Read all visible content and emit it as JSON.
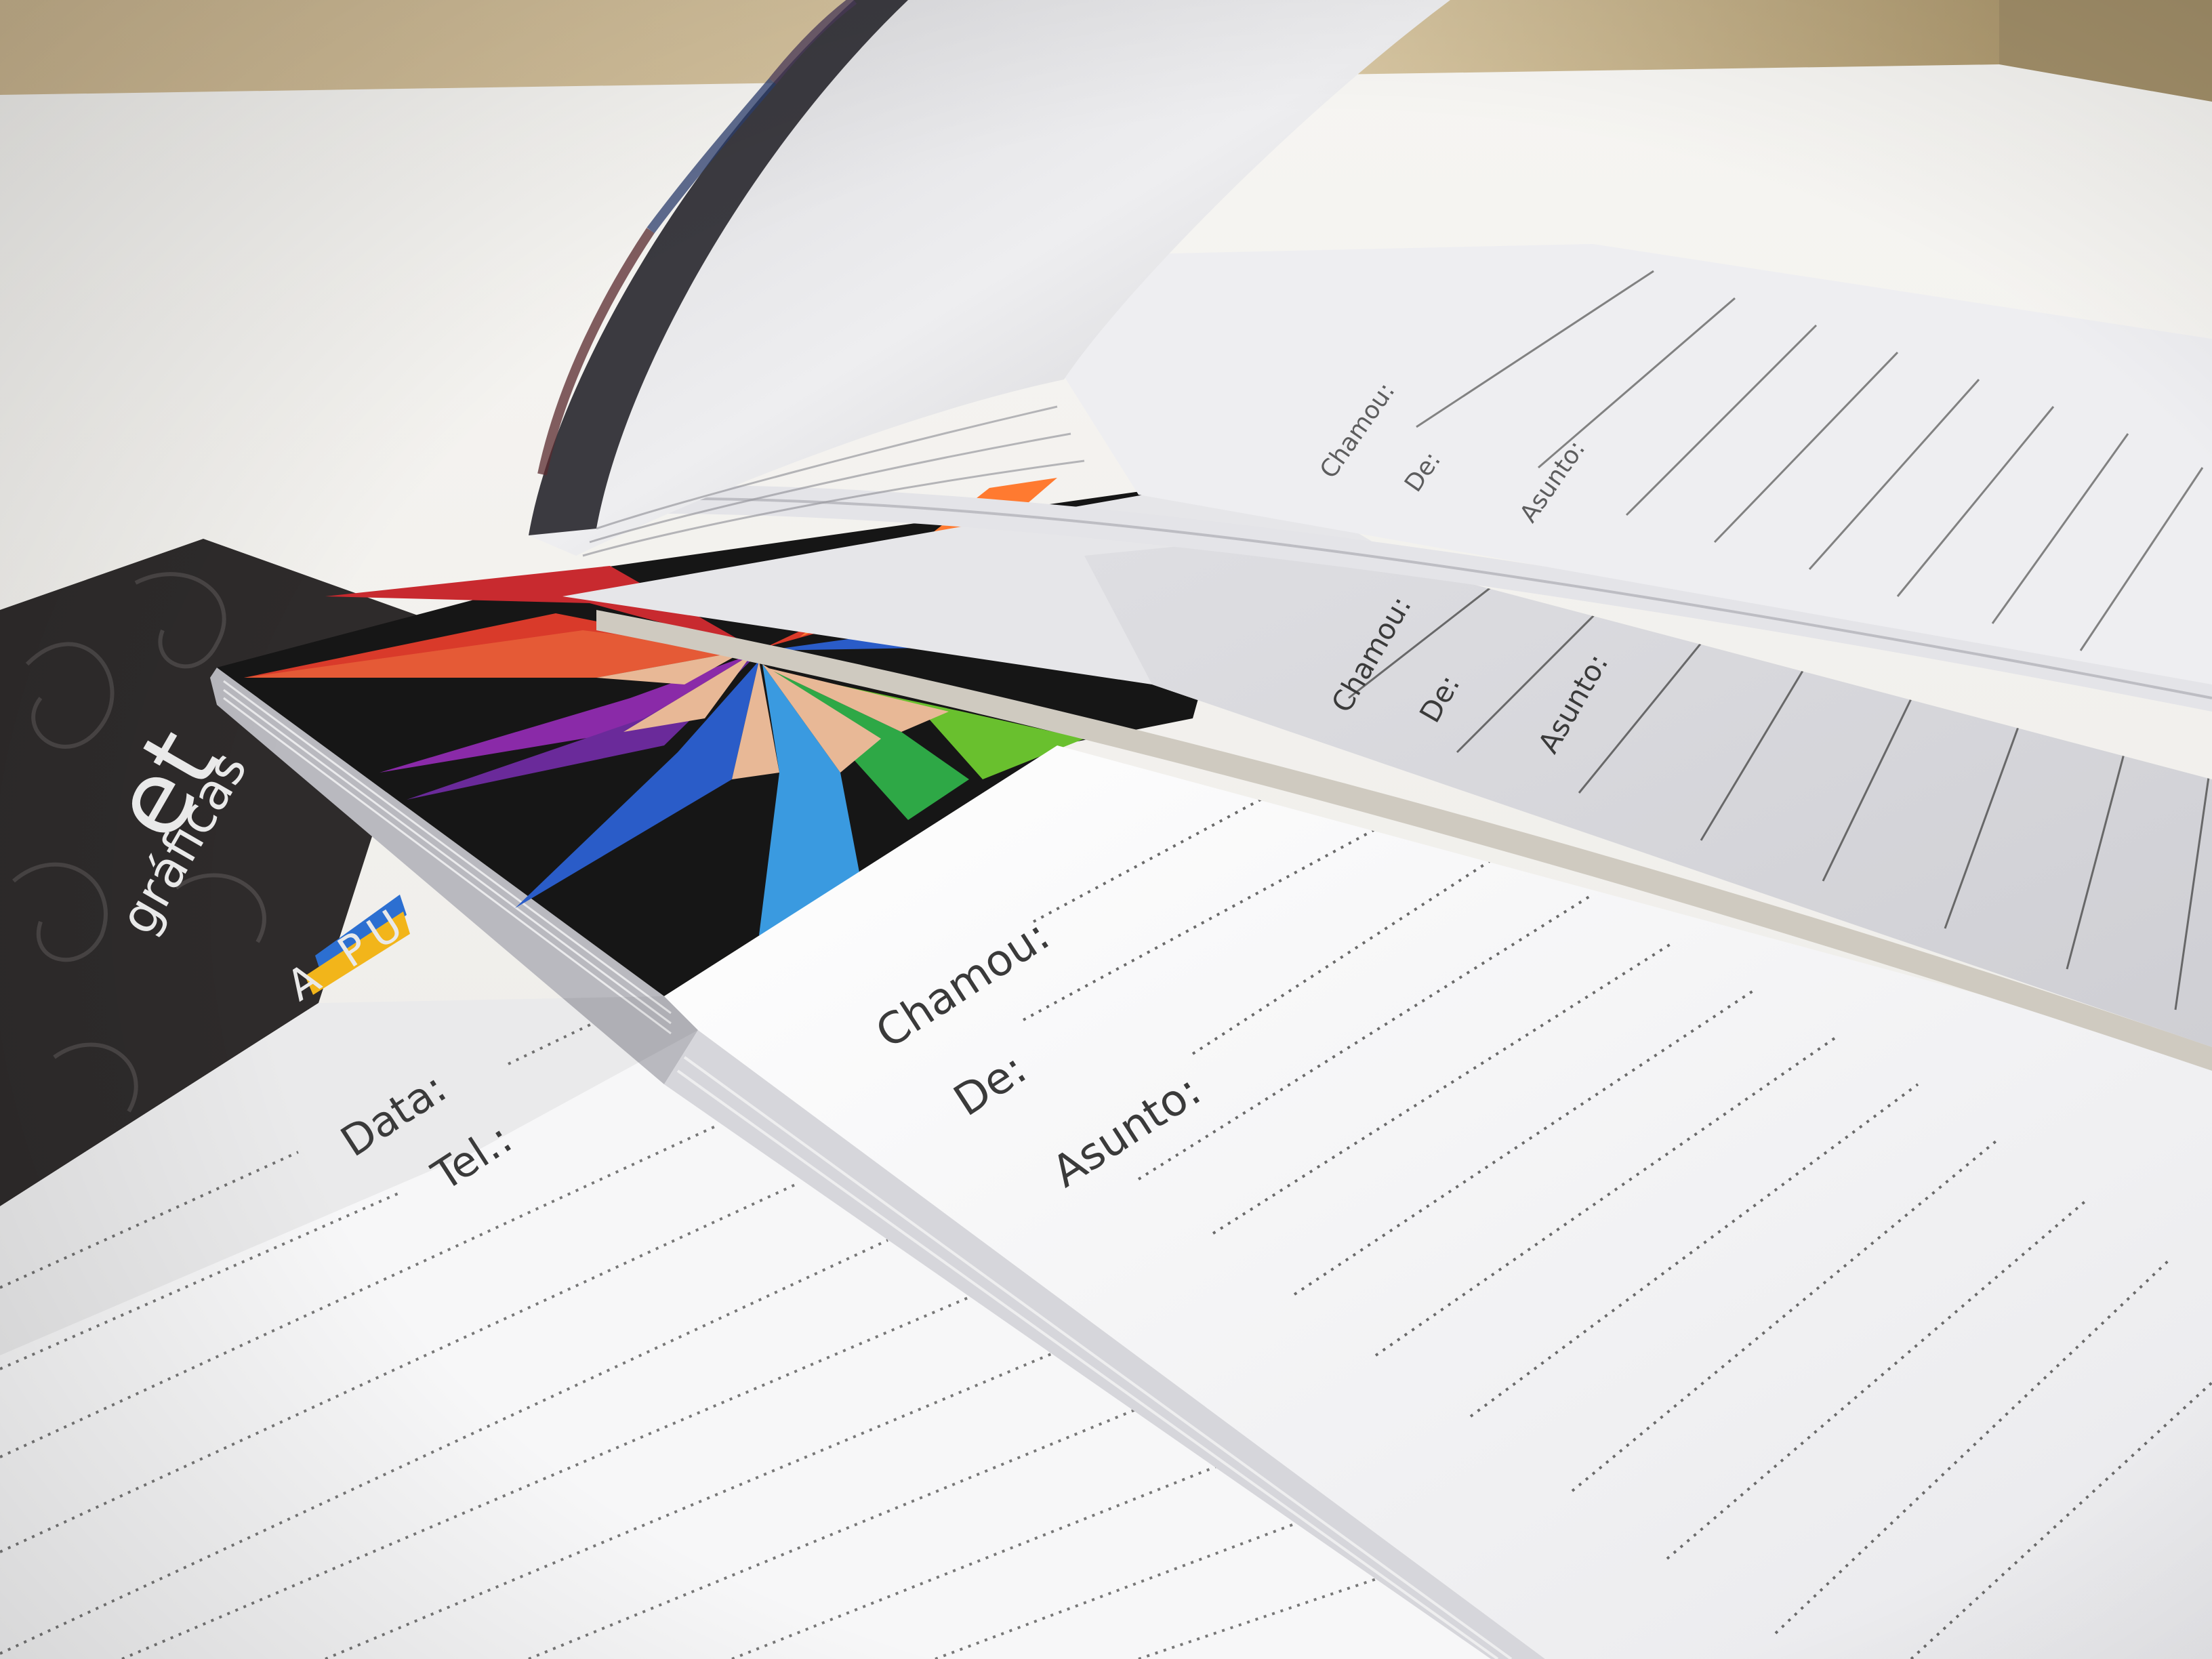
{
  "photo": {
    "subject": "notepad-printing-samples",
    "colors": {
      "desk": "#c9b28a",
      "sheet": "#f4f3f0",
      "dark_cover": "#2e2b2b",
      "accent_blue": "#2c6fd1",
      "accent_yellow": "#f2b51a"
    }
  },
  "front_pad": {
    "field_1": "Chamou:",
    "field_2": "De:",
    "field_3": "Asunto:"
  },
  "middle_pad": {
    "field_1": "Chamou:",
    "field_2": "De:",
    "field_3": "Asunto:"
  },
  "top_pad": {
    "field_1": "Chamou:",
    "field_2": "De:",
    "field_3": "Asunto:"
  },
  "left_pad": {
    "field_1": "Data:",
    "field_2": "Tel.:",
    "brand_fragment": "et",
    "brand_subtitle": "gráficas",
    "tagline_fragment": "A PU"
  }
}
